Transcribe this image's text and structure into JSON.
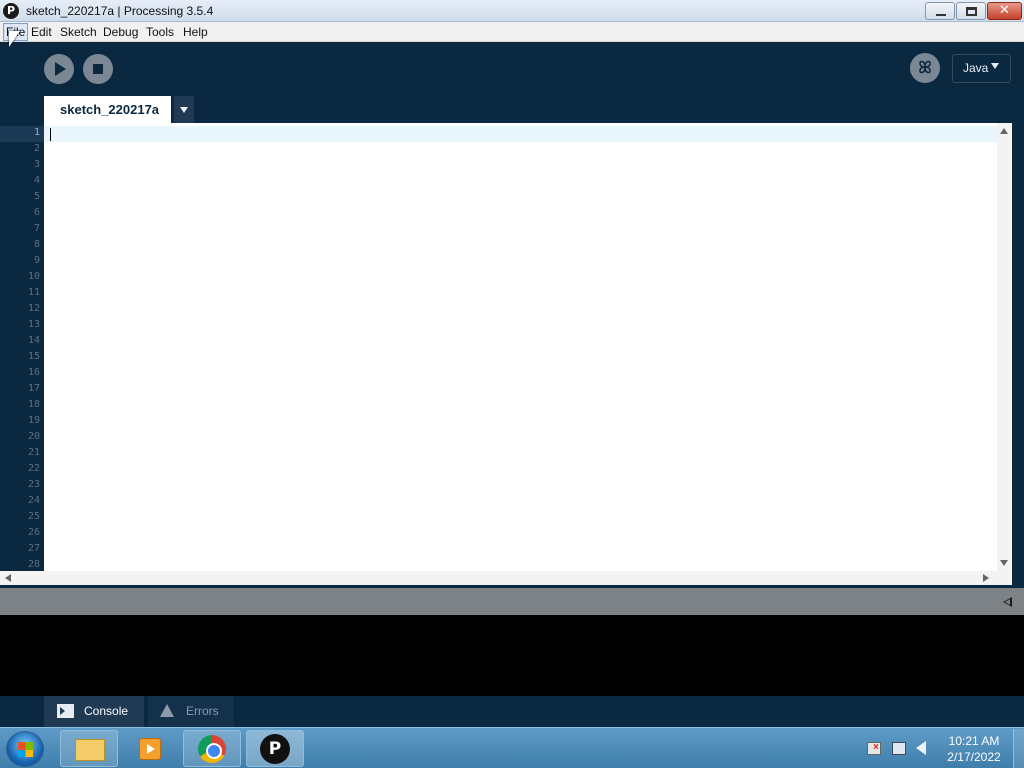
{
  "window": {
    "title": "sketch_220217a | Processing 3.5.4",
    "app_icon": "processing-logo-icon",
    "controls": [
      "minimize-icon",
      "maximize-icon",
      "close-icon"
    ]
  },
  "menu": {
    "items": [
      "File",
      "Edit",
      "Sketch",
      "Debug",
      "Tools",
      "Help"
    ],
    "active": "File"
  },
  "toolbar": {
    "run_icon": "play-icon",
    "stop_icon": "stop-icon",
    "debugger_icon": "debugger-icon",
    "mode": "Java"
  },
  "editor": {
    "tab_name": "sketch_220217a",
    "line_numbers": [
      "1",
      "2",
      "3",
      "4",
      "5",
      "6",
      "7",
      "8",
      "9",
      "10",
      "11",
      "12",
      "13",
      "14",
      "15",
      "16",
      "17",
      "18",
      "19",
      "20",
      "21",
      "22",
      "23",
      "24",
      "25",
      "26",
      "27",
      "28"
    ],
    "active_line": "1",
    "content": ""
  },
  "console": {
    "tabs": [
      {
        "label": "Console",
        "icon": "console-icon",
        "active": true
      },
      {
        "label": "Errors",
        "icon": "warning-icon",
        "active": false
      }
    ],
    "output": ""
  },
  "taskbar": {
    "apps": [
      "windows-explorer",
      "media-player",
      "google-chrome",
      "processing"
    ],
    "time": "10:21 AM",
    "date": "2/17/2022"
  },
  "colors": {
    "ide_background": "#0a2840",
    "editor_background": "#ffffff",
    "current_line": "#e9f6fb",
    "console_background": "#000000",
    "status_bar": "#7d8287"
  }
}
